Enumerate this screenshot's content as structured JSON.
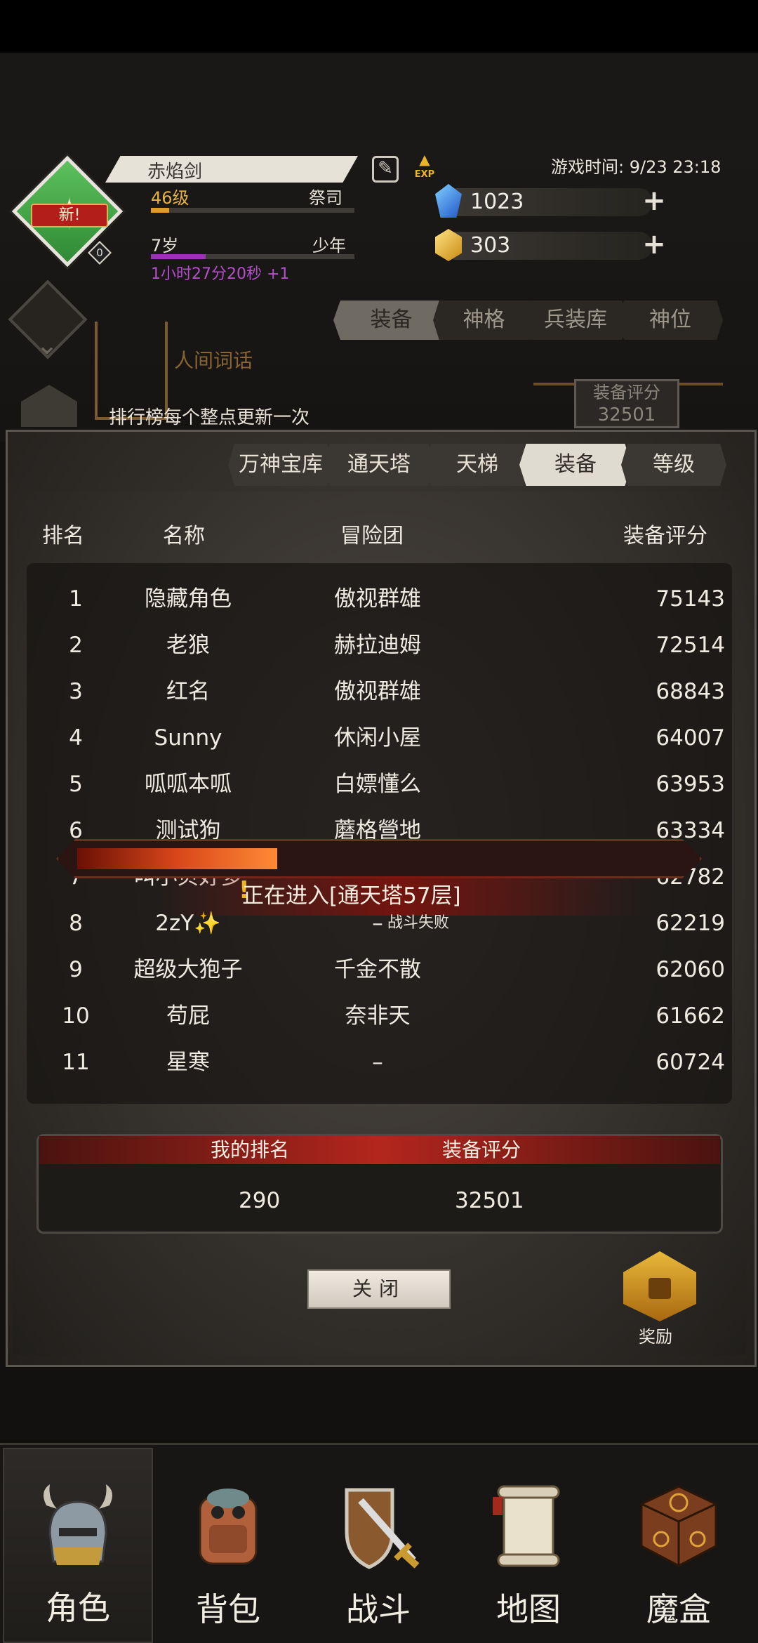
{
  "header": {
    "player_name": "赤焰剑",
    "new_badge": "新!",
    "avatar_level_num": "0",
    "level": "46级",
    "level_progress": 0.09,
    "class": "祭司",
    "age": "7岁",
    "age_progress": 0.27,
    "age_stage": "少年",
    "play_timer": "1小时27分20秒 +1",
    "exp_label": "EXP",
    "game_time": "游戏时间: 9/23 23:18",
    "gems_blue": "1023",
    "gems_gold": "303",
    "plus": "+",
    "edit_icon": "✎"
  },
  "menu_tabs": [
    "装备",
    "神格",
    "兵装库",
    "神位"
  ],
  "menu_active": "装备",
  "world_title": "人间词话",
  "equip_score": {
    "label": "装备评分",
    "value": "32501"
  },
  "notice": "排行榜每个整点更新一次",
  "rank_tabs": [
    "万神宝库",
    "通天塔",
    "天梯",
    "装备",
    "等级"
  ],
  "rank_active": "装备",
  "table": {
    "headers": [
      "排名",
      "名称",
      "冒险团",
      "装备评分"
    ],
    "rows": [
      [
        "1",
        "隐藏角色",
        "傲视群雄",
        "75143"
      ],
      [
        "2",
        "老狼",
        "赫拉迪姆",
        "72514"
      ],
      [
        "3",
        "红名",
        "傲视群雄",
        "68843"
      ],
      [
        "4",
        "Sunny",
        "休闲小屋",
        "64007"
      ],
      [
        "5",
        "呱呱本呱",
        "白嫖懂么",
        "63953"
      ],
      [
        "6",
        "测试狗",
        "蘑格營地",
        "63334"
      ],
      [
        "7",
        "叫小贝好多",
        "",
        "62782"
      ],
      [
        "8",
        "2zY✨",
        "–",
        "62219"
      ],
      [
        "9",
        "超级大狍子",
        "千金不散",
        "62060"
      ],
      [
        "10",
        "苟屁",
        "奈非天",
        "61662"
      ],
      [
        "11",
        "星寒",
        "–",
        "60724"
      ]
    ]
  },
  "loading": {
    "progress": 0.31,
    "excl": "!",
    "text": "正在进入[通天塔57层]",
    "sub": "战斗失败"
  },
  "my_rank": {
    "rank_label": "我的排名",
    "score_label": "装备评分",
    "rank_value": "290",
    "score_value": "32501"
  },
  "close_label": "关闭",
  "reward_label": "奖励",
  "nav": [
    {
      "label": "角色",
      "icon": "helmet-icon"
    },
    {
      "label": "背包",
      "icon": "backpack-icon"
    },
    {
      "label": "战斗",
      "icon": "sword-shield-icon"
    },
    {
      "label": "地图",
      "icon": "scroll-map-icon"
    },
    {
      "label": "魔盒",
      "icon": "magic-box-icon"
    }
  ],
  "nav_active": "角色"
}
